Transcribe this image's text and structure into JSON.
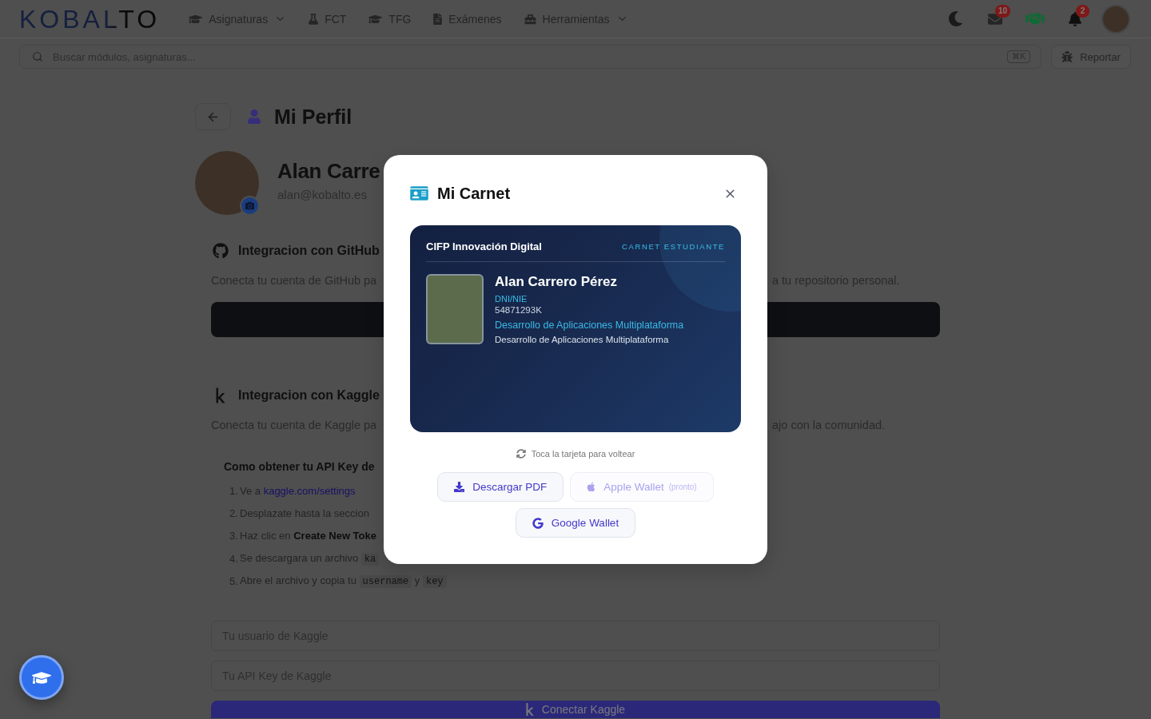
{
  "nav": {
    "logo": "KOBALTO",
    "items": [
      {
        "label": "Asignaturas",
        "dropdown": true
      },
      {
        "label": "FCT",
        "dropdown": false
      },
      {
        "label": "TFG",
        "dropdown": false
      },
      {
        "label": "Exámenes",
        "dropdown": false
      },
      {
        "label": "Herramientas",
        "dropdown": true
      }
    ],
    "actions": [
      {
        "kind": "theme"
      },
      {
        "kind": "mail",
        "badge": "10"
      },
      {
        "kind": "handshake"
      },
      {
        "kind": "bell",
        "badge": "2"
      },
      {
        "kind": "avatar"
      }
    ]
  },
  "search": {
    "placeholder": "Buscar módulos, asignaturas...",
    "shortcut": "⌘K"
  },
  "report_button": "Reportar",
  "profile": {
    "title": "Mi Perfil",
    "name": "Alan Carre",
    "email": "alan@kobalto.es"
  },
  "github": {
    "title": "Integracion con GitHub",
    "description": [
      "Conecta tu cuenta de GitHub pa",
      "a tu repositorio personal."
    ]
  },
  "kaggle": {
    "title": "Integracion con Kaggle",
    "description": [
      "Conecta tu cuenta de Kaggle pa",
      "ajo con la comunidad."
    ],
    "help": {
      "title": "Como obtener tu API Key de",
      "steps": [
        {
          "number": "1.",
          "parts": [
            {
              "kind": "text",
              "text": "Ve a"
            },
            {
              "kind": "link",
              "text": "kaggle.com/settings"
            }
          ]
        },
        {
          "number": "2.",
          "parts": [
            {
              "kind": "text",
              "text": "Desplazate hasta la seccion"
            }
          ]
        },
        {
          "number": "3.",
          "parts": [
            {
              "kind": "text",
              "text": "Haz clic en **Create New Toke**"
            }
          ]
        },
        {
          "number": "4.",
          "parts": [
            {
              "kind": "text",
              "text": "Se descargara un archivo"
            },
            {
              "kind": "code",
              "text": "ka"
            }
          ]
        },
        {
          "number": "5.",
          "parts": [
            {
              "kind": "text",
              "text": "Abre el archivo y copia tu"
            },
            {
              "kind": "code",
              "text": "username"
            },
            {
              "kind": "text",
              "text": "y"
            },
            {
              "kind": "code",
              "text": "key"
            }
          ]
        }
      ]
    },
    "fields": [
      {
        "placeholder": "Tu usuario de Kaggle"
      },
      {
        "placeholder": "Tu API Key de Kaggle"
      }
    ],
    "connect_button": "Conectar Kaggle"
  },
  "modal": {
    "title": "Mi Carnet",
    "card": {
      "institution": "CIFP Innovación Digital",
      "type_label": "CARNET ESTUDIANTE",
      "name": "Alan Carrero Pérez",
      "id_label": "DNI/NIE",
      "id_number": "54871293K",
      "program": "Desarrollo de Aplicaciones Multiplataforma",
      "program_detail": "Desarrollo de Aplicaciones Multiplataforma"
    },
    "flip_hint": "Toca la tarjeta para voltear",
    "actions": [
      {
        "kind": "download",
        "label": "Descargar PDF",
        "disabled": false
      },
      {
        "kind": "apple",
        "label": "Apple Wallet",
        "note": "(pronto)",
        "disabled": true
      },
      {
        "kind": "google",
        "label": "Google Wallet",
        "disabled": false
      }
    ]
  }
}
